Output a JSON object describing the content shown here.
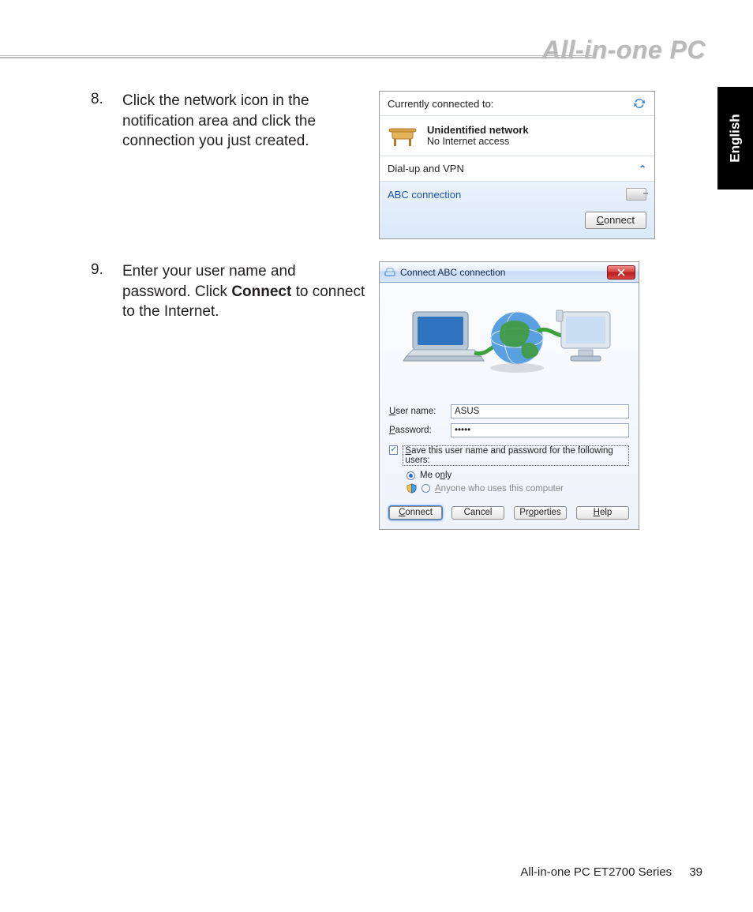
{
  "header": {
    "title": "All-in-one PC"
  },
  "lang_tab": "English",
  "steps": [
    {
      "num": "8.",
      "text": "Click the network icon in the notification area and click the connection you just created."
    },
    {
      "num": "9.",
      "text_a": "Enter your user name and password. Click ",
      "text_bold": "Connect",
      "text_b": " to connect to the Internet."
    }
  ],
  "flyout": {
    "connected_label": "Currently connected to:",
    "network_name": "Unidentified network",
    "network_status": "No Internet access",
    "section_label": "Dial-up and VPN",
    "connection_name": "ABC connection",
    "connect_btn": "Connect",
    "connect_accel": "C"
  },
  "dialog": {
    "title": "Connect ABC connection",
    "username_label_pre": "U",
    "username_label": "ser name:",
    "username_value": "ASUS",
    "password_label_pre": "P",
    "password_label": "assword:",
    "password_value": "•••••",
    "save_label_pre": "S",
    "save_label": "ave this user name and password for the following users:",
    "opt_me": "Me o",
    "opt_me_u": "n",
    "opt_me_post": "ly",
    "opt_anyone_pre": "A",
    "opt_anyone": "nyone who uses this computer",
    "buttons": {
      "connect_pre": "C",
      "connect": "onnect",
      "cancel": "Cancel",
      "properties_pre": "Pr",
      "properties_u": "o",
      "properties_post": "perties",
      "help_pre": "H",
      "help": "elp"
    }
  },
  "footer": {
    "series": "All-in-one PC ET2700 Series",
    "page": "39"
  }
}
